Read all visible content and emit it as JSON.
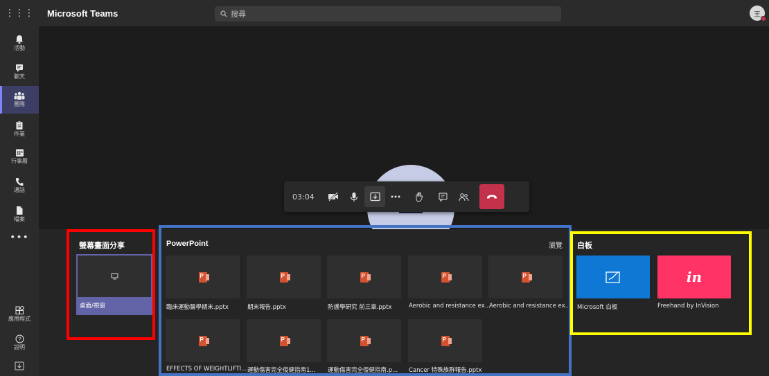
{
  "header": {
    "waffle": "⋮⋮⋮",
    "app_title": "Microsoft Teams",
    "search_placeholder": "搜尋",
    "avatar_initial": "王"
  },
  "rail": {
    "items": [
      {
        "label": "活動",
        "icon": "bell-icon"
      },
      {
        "label": "聊天",
        "icon": "chat-icon"
      },
      {
        "label": "團隊",
        "icon": "teams-icon"
      },
      {
        "label": "作業",
        "icon": "assignments-icon"
      },
      {
        "label": "行事曆",
        "icon": "calendar-icon"
      },
      {
        "label": "通話",
        "icon": "phone-icon"
      },
      {
        "label": "檔案",
        "icon": "files-icon"
      }
    ],
    "more": "•••",
    "apps_label": "應用程式",
    "help_label": "說明"
  },
  "call_controls": {
    "timer": "03:04"
  },
  "screen_share": {
    "title": "螢幕畫面分享",
    "desktop_label": "桌面/視窗"
  },
  "powerpoint": {
    "title": "PowerPoint",
    "browse": "瀏覽",
    "files": [
      "臨床運動醫學期末.pptx",
      "期末報告.pptx",
      "防護學研究 前三章.pptx",
      "Aerobic and resistance ex...",
      "Aerobic and resistance ex...",
      "EFFECTS OF WEIGHTLIFTI...",
      "運動傷害完全復健指南1...",
      "運動傷害完全復健指南.p...",
      "Cancer 特殊族群報告.pptx"
    ]
  },
  "whiteboard": {
    "title": "白板",
    "apps": [
      {
        "label": "Microsoft 白板",
        "color": "#0f78d4"
      },
      {
        "label": "Freehand by InVision",
        "color": "#ff3366",
        "mark": "in"
      }
    ]
  }
}
